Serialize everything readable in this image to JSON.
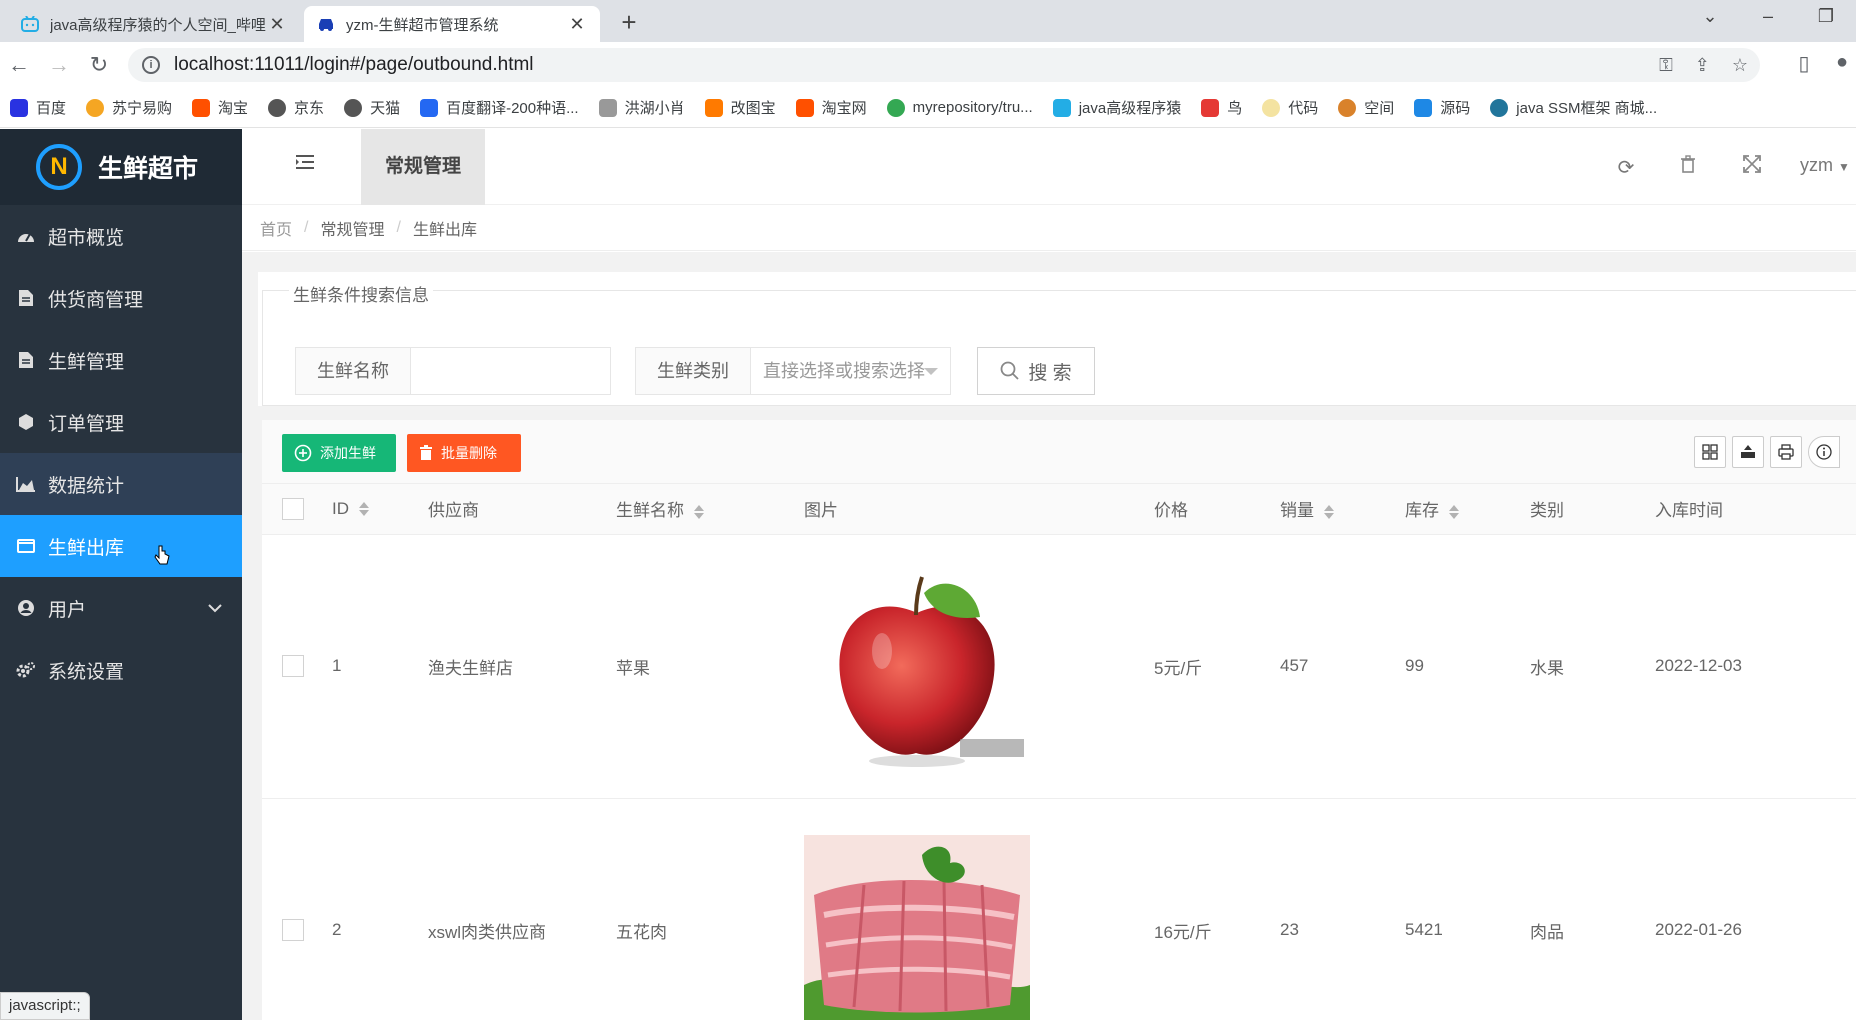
{
  "browser": {
    "tabs": [
      {
        "title": "java高级程序猿的个人空间_哔哩哔哩",
        "active": false
      },
      {
        "title": "yzm-生鲜超市管理系统",
        "active": true
      }
    ],
    "url": "localhost:11011/login#/page/outbound.html",
    "bookmarks": [
      "百度",
      "苏宁易购",
      "淘宝",
      "京东",
      "天猫",
      "百度翻译-200种语...",
      "洪湖小肖",
      "改图宝",
      "淘宝网",
      "myrepository/tru...",
      "java高级程序猿",
      "鸟",
      "代码",
      "空间",
      "源码",
      "java SSM框架 商城..."
    ],
    "status_text": "javascript:;"
  },
  "app": {
    "logo_text": "生鲜超市",
    "logo_letter": "N",
    "menu": [
      {
        "label": "超市概览",
        "icon": "dashboard-icon"
      },
      {
        "label": "供货商管理",
        "icon": "file-icon"
      },
      {
        "label": "生鲜管理",
        "icon": "file-icon"
      },
      {
        "label": "订单管理",
        "icon": "cube-icon"
      },
      {
        "label": "数据统计",
        "icon": "area-chart-icon"
      },
      {
        "label": "生鲜出库",
        "icon": "window-icon"
      },
      {
        "label": "用户",
        "icon": "user-icon"
      },
      {
        "label": "系统设置",
        "icon": "cogs-icon"
      }
    ],
    "header": {
      "tab": "常规管理",
      "user": "yzm"
    },
    "breadcrumb": [
      "首页",
      "常规管理",
      "生鲜出库"
    ],
    "search": {
      "legend": "生鲜条件搜索信息",
      "name_label": "生鲜名称",
      "name_value": "",
      "category_label": "生鲜类别",
      "category_placeholder": "直接选择或搜索选择",
      "search_button": "搜 索"
    },
    "toolbar": {
      "add_button": "添加生鲜",
      "batch_delete_button": "批量删除"
    },
    "table": {
      "columns": [
        "ID",
        "供应商",
        "生鲜名称",
        "图片",
        "价格",
        "销量",
        "库存",
        "类别",
        "入库时间"
      ],
      "rows": [
        {
          "id": "1",
          "supplier": "渔夫生鲜店",
          "name": "苹果",
          "image": "apple",
          "price": "5元/斤",
          "sales": "457",
          "stock": "99",
          "category": "水果",
          "date": "2022-12-03"
        },
        {
          "id": "2",
          "supplier": "xswl肉类供应商",
          "name": "五花肉",
          "image": "pork",
          "price": "16元/斤",
          "sales": "23",
          "stock": "5421",
          "category": "肉品",
          "date": "2022-01-26"
        }
      ]
    },
    "colors": {
      "sidebar": "#28333e",
      "active": "#1e9fff",
      "add": "#16b777",
      "delete": "#ff5722"
    }
  }
}
